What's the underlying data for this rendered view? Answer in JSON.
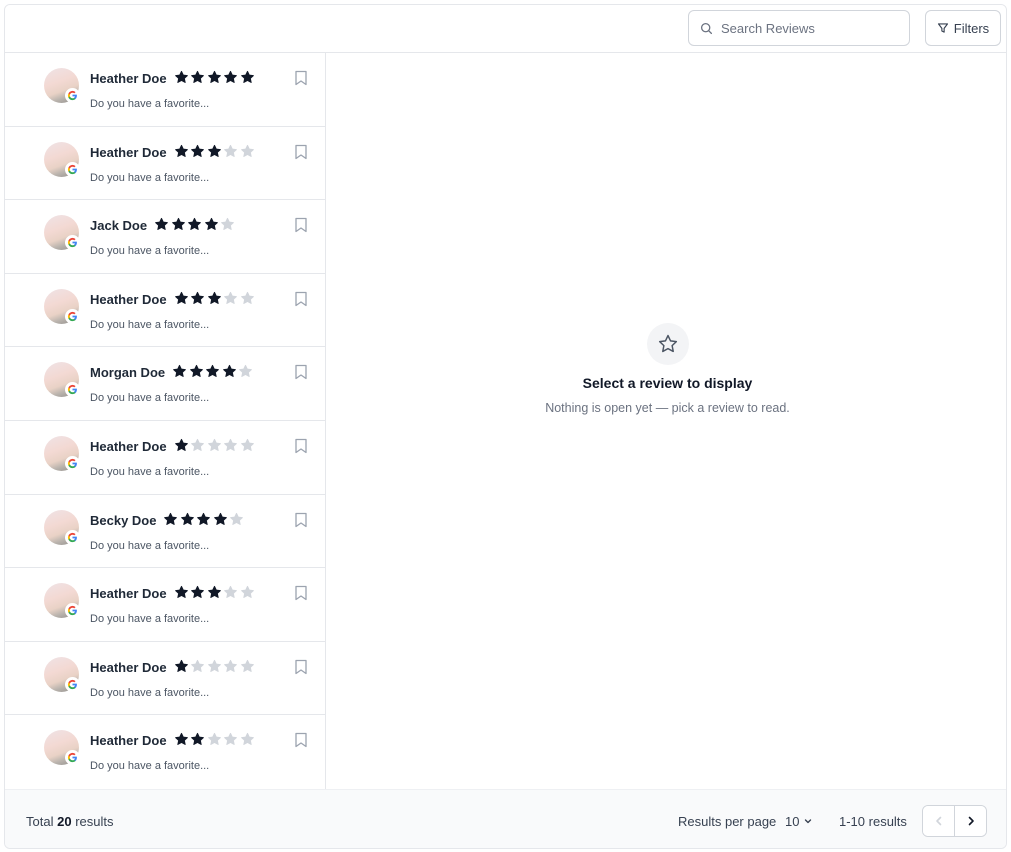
{
  "search": {
    "placeholder": "Search Reviews",
    "icon": "search-icon"
  },
  "filters": {
    "label": "Filters",
    "icon": "filter-icon"
  },
  "annotation": {
    "color": "#ef4444"
  },
  "colors": {
    "star_filled": "#111827",
    "star_empty": "#d1d5db"
  },
  "reviews": [
    {
      "name": "Heather Doe",
      "rating": 5,
      "snippet": "Do you have a favorite..."
    },
    {
      "name": "Heather Doe",
      "rating": 3,
      "snippet": "Do you have a favorite..."
    },
    {
      "name": "Jack Doe",
      "rating": 4,
      "snippet": "Do you have a favorite..."
    },
    {
      "name": "Heather Doe",
      "rating": 3,
      "snippet": "Do you have a favorite..."
    },
    {
      "name": "Morgan Doe",
      "rating": 4,
      "snippet": "Do you have a favorite..."
    },
    {
      "name": "Heather Doe",
      "rating": 1,
      "snippet": "Do you have a favorite..."
    },
    {
      "name": "Becky Doe",
      "rating": 4,
      "snippet": "Do you have a favorite..."
    },
    {
      "name": "Heather Doe",
      "rating": 3,
      "snippet": "Do you have a favorite..."
    },
    {
      "name": "Heather Doe",
      "rating": 1,
      "snippet": "Do you have a favorite..."
    },
    {
      "name": "Heather Doe",
      "rating": 2,
      "snippet": "Do you have a favorite..."
    }
  ],
  "empty_state": {
    "icon": "star-icon",
    "title": "Select a review to display",
    "subtitle": "Nothing is open yet — pick a review to read."
  },
  "footer": {
    "total_prefix": "Total",
    "total_count": "20",
    "total_suffix": "results",
    "rpp_label": "Results per page",
    "rpp_value": "10",
    "range": "1-10 results"
  }
}
